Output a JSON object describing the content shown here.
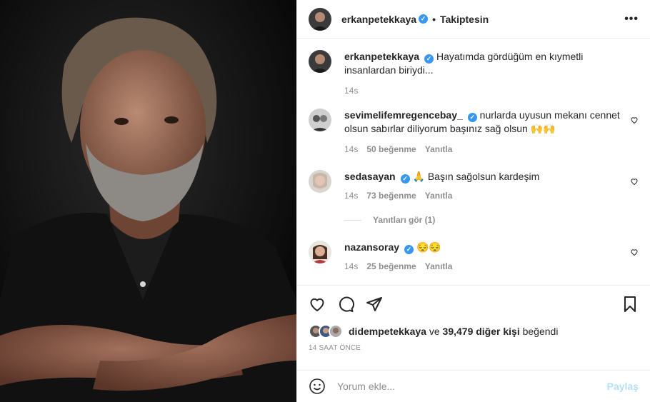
{
  "post": {
    "author": "erkanpetekkaya",
    "follow_separator": "•",
    "follow_status": "Takiptesin",
    "more": "•••"
  },
  "caption": {
    "user": "erkanpetekkaya",
    "text": "Hayatımda gördüğüm en kıymetli insanlardan biriydi...",
    "time": "14s"
  },
  "comments": [
    {
      "user": "sevimelifemregencebay_",
      "text": "nurlarda uyusun mekanı cennet olsun sabırlar diliyorum başınız sağ olsun 🙌🙌",
      "time": "14s",
      "likes": "50 beğenme",
      "reply": "Yanıtla"
    },
    {
      "user": "sedasayan",
      "text": "🙏 Başın sağolsun kardeşim",
      "time": "14s",
      "likes": "73 beğenme",
      "reply": "Yanıtla"
    },
    {
      "user": "nazansoray",
      "text": "😔😔",
      "time": "14s",
      "likes": "25 beğenme",
      "reply": "Yanıtla"
    }
  ],
  "view_replies": "Yanıtları gör (1)",
  "likes": {
    "user": "didempetekkaya",
    "and": "ve",
    "others": "39,479 diğer kişi",
    "suffix": "beğendi"
  },
  "time_ago": "14 SAAT ÖNCE",
  "add_comment": {
    "placeholder": "Yorum ekle...",
    "post_label": "Paylaş"
  },
  "colors": {
    "verified": "#3897f0",
    "meta_gray": "#8e8e8e",
    "post_disabled": "#b2dffc"
  }
}
